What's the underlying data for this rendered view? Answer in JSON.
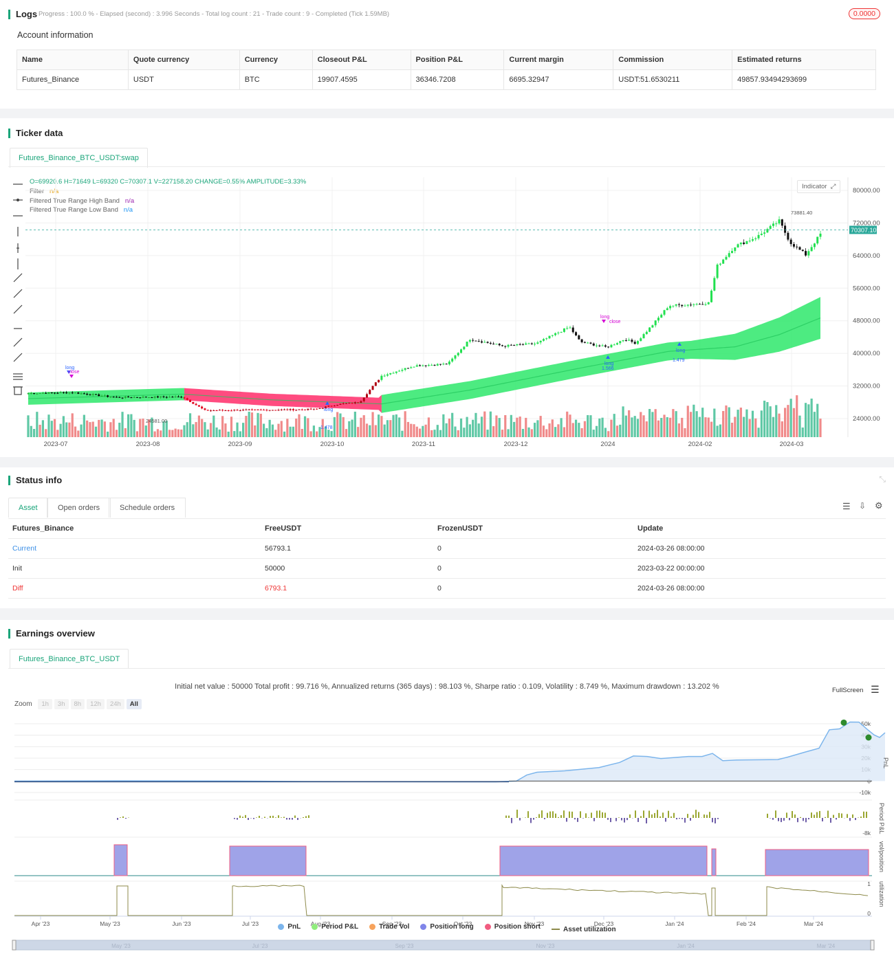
{
  "logs": {
    "title": "Logs",
    "progress_text": "Progress : 100.0 % - Elapsed (second) : 3.996  Seconds - Total log count : 21 - Trade count : 9 - Completed (Tick 1.59MB)",
    "badge": "0.0000"
  },
  "account": {
    "title": "Account information",
    "headers": [
      "Name",
      "Quote currency",
      "Currency",
      "Closeout P&L",
      "Position P&L",
      "Current margin",
      "Commission",
      "Estimated returns"
    ],
    "row": [
      "Futures_Binance",
      "USDT",
      "BTC",
      "19907.4595",
      "36346.7208",
      "6695.32947",
      "USDT:51.6530211",
      "49857.93494293699"
    ]
  },
  "ticker": {
    "title": "Ticker data",
    "tab": "Futures_Binance_BTC_USDT:swap",
    "ohlc": "O=69920.6 H=71649 L=69320 C=70307.1 V=227158.20 CHANGE=0.55% AMPLITUDE=3.33%",
    "legend": [
      {
        "label": "Filter",
        "value": "n/a",
        "color": "#e3a21a"
      },
      {
        "label": "Filtered True Range High Band",
        "value": "n/a",
        "color": "#9c27b0"
      },
      {
        "label": "Filtered True Range Low Band",
        "value": "n/a",
        "color": "#2196f3"
      }
    ],
    "indicator_btn": "Indicator",
    "price_ticks": [
      "80000.00",
      "72000.00",
      "64000.00",
      "56000.00",
      "48000.00",
      "40000.00",
      "32000.00",
      "24000.00"
    ],
    "last_price": "70307.10",
    "high_label": "73881.40",
    "low_label": "24581.00",
    "date_ticks": [
      "2023-07",
      "2023-08",
      "2023-09",
      "2023-10",
      "2023-11",
      "2023-12",
      "2024",
      "2024-02",
      "2024-03"
    ],
    "signals": [
      "long",
      "close",
      "long",
      "long",
      "long",
      "1.566",
      "long",
      "1.479",
      "long",
      "1.478",
      "long",
      "close"
    ]
  },
  "status": {
    "title": "Status info",
    "tabs": [
      "Asset",
      "Open orders",
      "Schedule orders"
    ],
    "headers": [
      "Futures_Binance",
      "FreeUSDT",
      "FrozenUSDT",
      "Update"
    ],
    "rows": [
      [
        "Current",
        "56793.1",
        "0",
        "2024-03-26 08:00:00"
      ],
      [
        "Init",
        "50000",
        "0",
        "2023-03-22 00:00:00"
      ],
      [
        "Diff",
        "6793.1",
        "0",
        "2024-03-26 08:00:00"
      ]
    ]
  },
  "earnings": {
    "title": "Earnings overview",
    "tab": "Futures_Binance_BTC_USDT",
    "summary": "Initial net value : 50000  Total profit : 99.716 %, Annualized returns (365 days) : 98.103 %, Sharpe ratio : 0.109, Volatility : 8.749 %, Maximum drawdown : 13.202 %",
    "fullscreen": "FullScreen",
    "zoom_label": "Zoom",
    "zoom_buttons": [
      "1h",
      "3h",
      "8h",
      "12h",
      "24h",
      "All"
    ],
    "pnl_ticks": [
      "50k",
      "40k",
      "30k",
      "20k",
      "10k",
      "0",
      "-10k"
    ],
    "ppl_tick": "-8k",
    "axis_titles": [
      "PnL",
      "Period P&L",
      "vol/position",
      "utilization"
    ],
    "util_ticks": [
      "1",
      "0"
    ],
    "date_ticks": [
      "Apr '23",
      "May '23",
      "Jun '23",
      "Jul '23",
      "Aug '23",
      "Sep '23",
      "Oct '23",
      "Nov '23",
      "Dec '23",
      "Jan '24",
      "Feb '24",
      "Mar '24"
    ],
    "navigator_ticks": [
      "May '23",
      "Jul '23",
      "Sep '23",
      "Nov '23",
      "Jan '24",
      "Mar '24"
    ],
    "legend": [
      {
        "label": "PnL",
        "color": "#7cb5ec"
      },
      {
        "label": "Period P&L",
        "color": "#90ed7d"
      },
      {
        "label": "Trade Vol",
        "color": "#f7a35c"
      },
      {
        "label": "Position long",
        "color": "#8085e9"
      },
      {
        "label": "Position short",
        "color": "#f15c80"
      },
      {
        "label": "Asset utilization",
        "color": "#8d8a4a"
      }
    ]
  }
}
